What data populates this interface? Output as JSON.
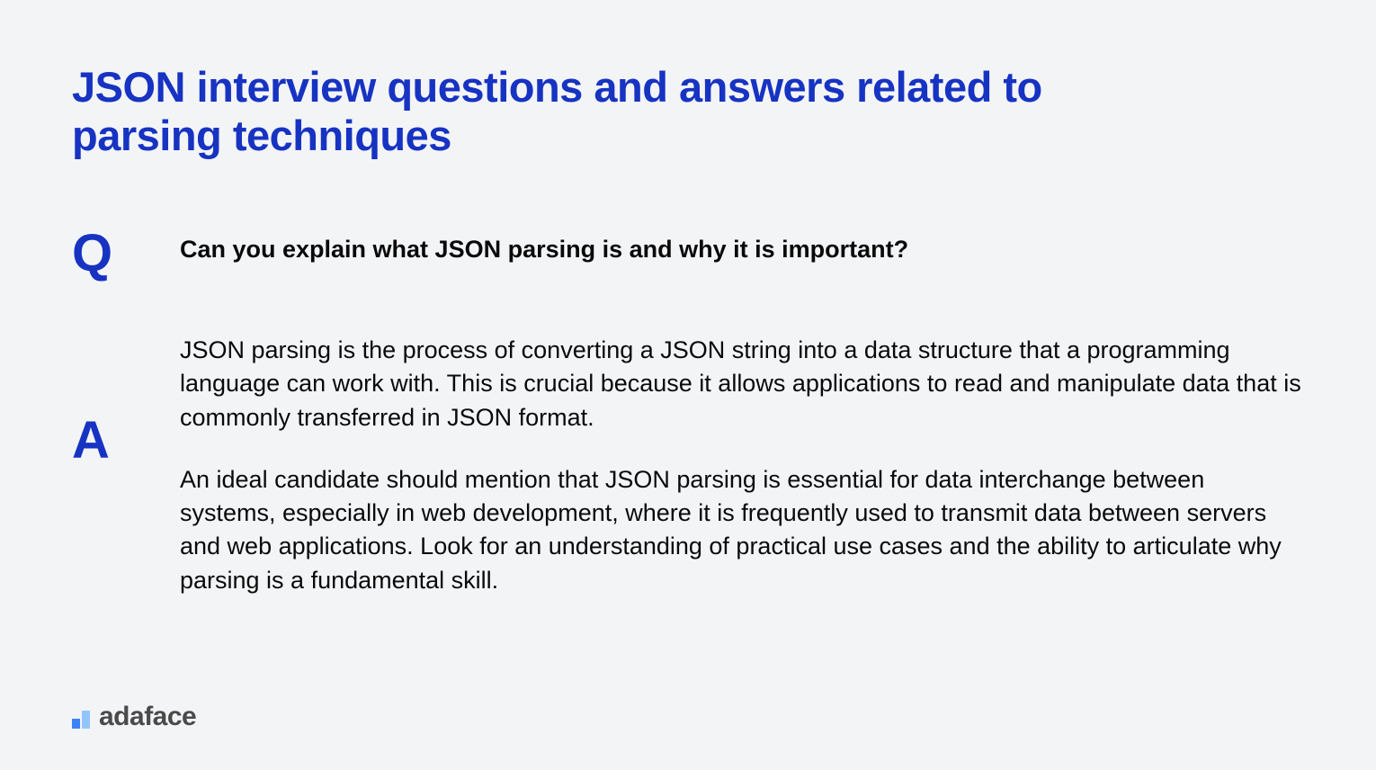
{
  "title": "JSON interview questions and answers related to parsing techniques",
  "question": {
    "marker": "Q",
    "text": "Can you explain what JSON parsing is and why it is important?"
  },
  "answer": {
    "marker": "A",
    "paragraph1": "JSON parsing is the process of converting a JSON string into a data structure that a programming language can work with. This is crucial because it allows applications to read and manipulate data that is commonly transferred in JSON format.",
    "paragraph2": "An ideal candidate should mention that JSON parsing is essential for data interchange between systems, especially in web development, where it is frequently used to transmit data between servers and web applications. Look for an understanding of practical use cases and the ability to articulate why parsing is a fundamental skill."
  },
  "brand": "adaface"
}
